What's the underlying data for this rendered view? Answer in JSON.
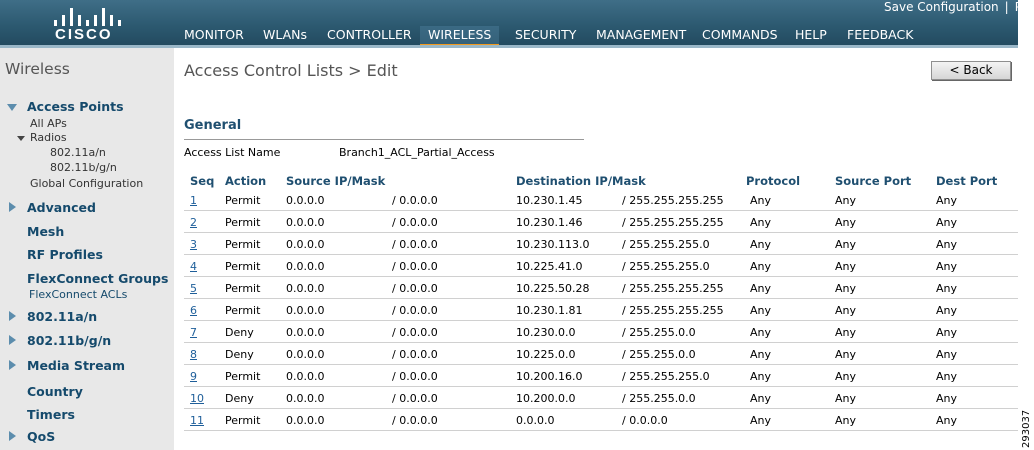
{
  "header": {
    "brand": "CISCO",
    "util_links": [
      "Save Configuration",
      "|",
      "P"
    ],
    "nav": [
      "MONITOR",
      "WLANs",
      "CONTROLLER",
      "WIRELESS",
      "SECURITY",
      "MANAGEMENT",
      "COMMANDS",
      "HELP",
      "FEEDBACK"
    ],
    "active_nav": "WIRELESS",
    "accent_color": "#f39a1d"
  },
  "sidebar": {
    "title": "Wireless",
    "access_points": "Access Points",
    "all_aps": "All APs",
    "radios": "Radios",
    "radio_a": "802.11a/n",
    "radio_bg": "802.11b/g/n",
    "global_config": "Global Configuration",
    "advanced": "Advanced",
    "mesh": "Mesh",
    "rf_profiles": "RF Profiles",
    "flexconnect_groups": "FlexConnect Groups",
    "flexconnect_acls": "FlexConnect ACLs",
    "band_a": "802.11a/n",
    "band_bg": "802.11b/g/n",
    "media_stream": "Media Stream",
    "country": "Country",
    "timers": "Timers",
    "qos": "QoS"
  },
  "content": {
    "title": "Access Control Lists > Edit",
    "back_button": "< Back",
    "section": "General",
    "acl_name_label": "Access List Name",
    "acl_name_value": "Branch1_ACL_Partial_Access"
  },
  "table": {
    "headers": [
      "Seq",
      "Action",
      "Source IP/Mask",
      "Destination IP/Mask",
      "Protocol",
      "Source Port",
      "Dest Port"
    ],
    "rows": [
      {
        "seq": "1",
        "action": "Permit",
        "src_ip": "0.0.0.0",
        "src_mask": "/ 0.0.0.0",
        "dst_ip": "10.230.1.45",
        "dst_mask": "/ 255.255.255.255",
        "protocol": "Any",
        "src_port": "Any",
        "dst_port": "Any"
      },
      {
        "seq": "2",
        "action": "Permit",
        "src_ip": "0.0.0.0",
        "src_mask": "/ 0.0.0.0",
        "dst_ip": "10.230.1.46",
        "dst_mask": "/ 255.255.255.255",
        "protocol": "Any",
        "src_port": "Any",
        "dst_port": "Any"
      },
      {
        "seq": "3",
        "action": "Permit",
        "src_ip": "0.0.0.0",
        "src_mask": "/ 0.0.0.0",
        "dst_ip": "10.230.113.0",
        "dst_mask": "/ 255.255.255.0",
        "protocol": "Any",
        "src_port": "Any",
        "dst_port": "Any"
      },
      {
        "seq": "4",
        "action": "Permit",
        "src_ip": "0.0.0.0",
        "src_mask": "/ 0.0.0.0",
        "dst_ip": "10.225.41.0",
        "dst_mask": "/ 255.255.255.0",
        "protocol": "Any",
        "src_port": "Any",
        "dst_port": "Any"
      },
      {
        "seq": "5",
        "action": "Permit",
        "src_ip": "0.0.0.0",
        "src_mask": "/ 0.0.0.0",
        "dst_ip": "10.225.50.28",
        "dst_mask": "/ 255.255.255.255",
        "protocol": "Any",
        "src_port": "Any",
        "dst_port": "Any"
      },
      {
        "seq": "6",
        "action": "Permit",
        "src_ip": "0.0.0.0",
        "src_mask": "/ 0.0.0.0",
        "dst_ip": "10.230.1.81",
        "dst_mask": "/ 255.255.255.255",
        "protocol": "Any",
        "src_port": "Any",
        "dst_port": "Any"
      },
      {
        "seq": "7",
        "action": "Deny",
        "src_ip": "0.0.0.0",
        "src_mask": "/ 0.0.0.0",
        "dst_ip": "10.230.0.0",
        "dst_mask": "/ 255.255.0.0",
        "protocol": "Any",
        "src_port": "Any",
        "dst_port": "Any"
      },
      {
        "seq": "8",
        "action": "Deny",
        "src_ip": "0.0.0.0",
        "src_mask": "/ 0.0.0.0",
        "dst_ip": "10.225.0.0",
        "dst_mask": "/ 255.255.0.0",
        "protocol": "Any",
        "src_port": "Any",
        "dst_port": "Any"
      },
      {
        "seq": "9",
        "action": "Permit",
        "src_ip": "0.0.0.0",
        "src_mask": "/ 0.0.0.0",
        "dst_ip": "10.200.16.0",
        "dst_mask": "/ 255.255.255.0",
        "protocol": "Any",
        "src_port": "Any",
        "dst_port": "Any"
      },
      {
        "seq": "10",
        "action": "Deny",
        "src_ip": "0.0.0.0",
        "src_mask": "/ 0.0.0.0",
        "dst_ip": "10.200.0.0",
        "dst_mask": "/ 255.255.0.0",
        "protocol": "Any",
        "src_port": "Any",
        "dst_port": "Any"
      },
      {
        "seq": "11",
        "action": "Permit",
        "src_ip": "0.0.0.0",
        "src_mask": "/ 0.0.0.0",
        "dst_ip": "0.0.0.0",
        "dst_mask": "/ 0.0.0.0",
        "protocol": "Any",
        "src_port": "Any",
        "dst_port": "Any"
      }
    ]
  },
  "figure_id": "293037"
}
